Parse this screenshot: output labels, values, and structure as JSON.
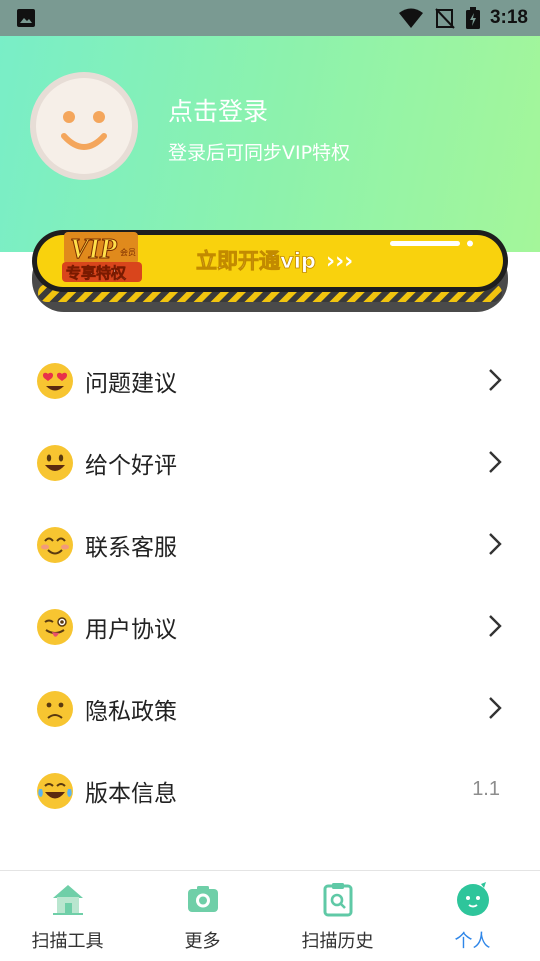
{
  "status_bar": {
    "time": "3:18",
    "icons": [
      "gallery-icon",
      "wifi-icon",
      "no-sim-icon",
      "battery-icon"
    ]
  },
  "profile": {
    "login_title": "点击登录",
    "login_subtitle": "登录后可同步VIP特权",
    "avatar_icon": "smiley-avatar-icon"
  },
  "vip_banner": {
    "badge_top": "VIP",
    "badge_small": "会员",
    "badge_bottom": "专享特权",
    "cta": "立即开通vip",
    "arrows": "›››",
    "colors": {
      "fill": "#f9d20d",
      "border": "#1e1e1e",
      "text": "#ffffff"
    }
  },
  "menu": {
    "items": [
      {
        "label": "问题建议",
        "icon": "heart-eyes-emoji-icon"
      },
      {
        "label": "给个好评",
        "icon": "grinning-emoji-icon"
      },
      {
        "label": "联系客服",
        "icon": "blushing-smile-emoji-icon"
      },
      {
        "label": "用户协议",
        "icon": "winking-tongue-emoji-icon"
      },
      {
        "label": "隐私政策",
        "icon": "frowning-emoji-icon"
      },
      {
        "label": "版本信息",
        "icon": "tears-of-joy-emoji-icon",
        "value": "1.1"
      }
    ]
  },
  "tabbar": {
    "tabs": [
      {
        "label": "扫描工具",
        "icon": "house-icon"
      },
      {
        "label": "更多",
        "icon": "camera-icon"
      },
      {
        "label": "扫描历史",
        "icon": "clipboard-search-icon"
      },
      {
        "label": "个人",
        "icon": "user-face-icon",
        "active": true
      }
    ],
    "active_color": "#2f86e8",
    "icon_color": "#5fd0b0"
  }
}
